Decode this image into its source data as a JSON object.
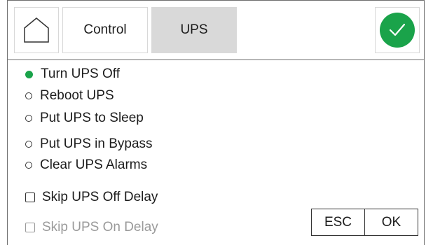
{
  "toolbar": {
    "home_icon": "home-icon",
    "tabs": [
      {
        "label": "Control",
        "active": false
      },
      {
        "label": "UPS",
        "active": true
      }
    ],
    "confirm_icon": "checkmark-icon",
    "confirm_color": "#1aa34a"
  },
  "options": [
    {
      "label": "Turn UPS Off",
      "selected": true
    },
    {
      "label": "Reboot UPS",
      "selected": false
    },
    {
      "label": "Put UPS to Sleep",
      "selected": false
    },
    {
      "label": "Put UPS in Bypass",
      "selected": false
    },
    {
      "label": "Clear UPS Alarms",
      "selected": false
    }
  ],
  "checkboxes": [
    {
      "label": "Skip UPS Off Delay",
      "checked": false,
      "enabled": true
    },
    {
      "label": "Skip UPS On Delay",
      "checked": false,
      "enabled": false
    }
  ],
  "buttons": {
    "esc_label": "ESC",
    "ok_label": "OK"
  }
}
